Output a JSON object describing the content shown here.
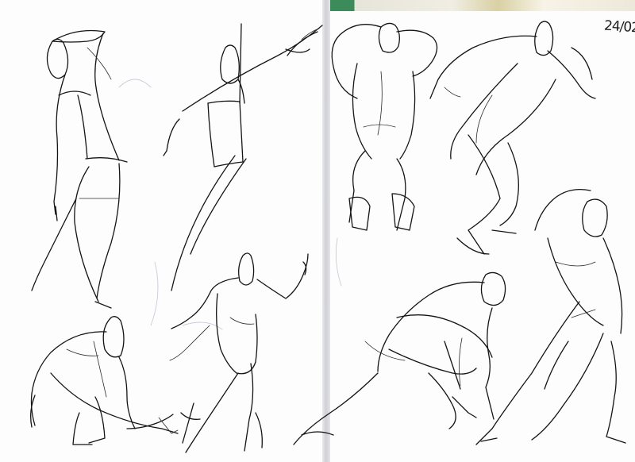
{
  "sketchbook": {
    "date_note": "24/02",
    "paper_color": "#fdfdfd",
    "ink_color": "#141414"
  }
}
